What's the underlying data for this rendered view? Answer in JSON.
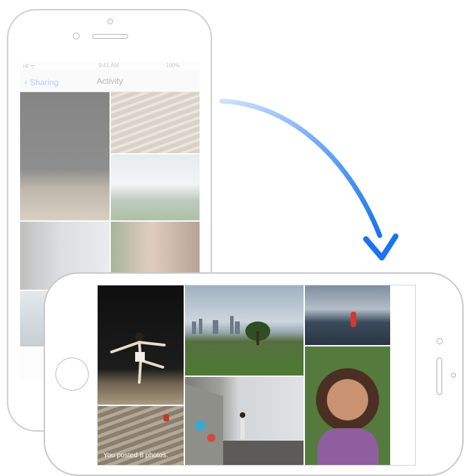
{
  "portrait_phone": {
    "status": {
      "left": "ııll ᯤ",
      "time": "9:41 AM",
      "battery": "100%"
    },
    "nav": {
      "back_label": "Sharing",
      "title": "Activity"
    }
  },
  "landscape_phone": {
    "caption": "You posted 8 photos."
  },
  "colors": {
    "accent": "#1a73f0",
    "link": "#6aa7f5",
    "frame": "#cfcfcf"
  },
  "icons": [
    "chevron-left-icon",
    "home-button-icon",
    "arrow-icon"
  ]
}
